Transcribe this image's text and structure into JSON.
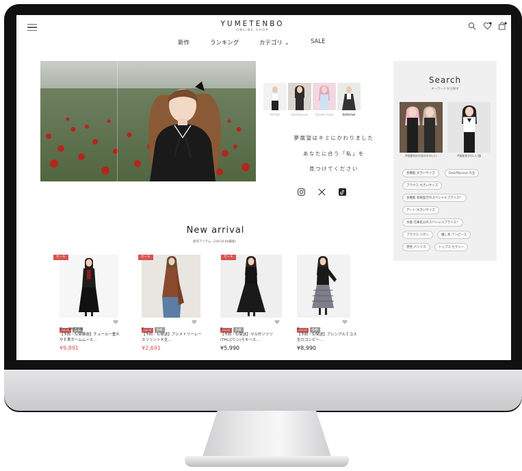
{
  "header": {
    "brand": "YUMETENBO",
    "sub": "ONLINE SHOP",
    "nav": [
      "新作",
      "ランキング",
      "カテゴリ ⌄",
      "SALE"
    ]
  },
  "hero": {
    "thumb_labels": [
      "MIYUKI",
      "DearMyLove",
      "Famille fraise",
      "bohmai"
    ],
    "tagline": [
      "夢展望はキミにかわりました",
      "あなたに合う「私」を",
      "見つけてください"
    ]
  },
  "social": [
    "instagram-icon",
    "x-icon",
    "tiktok-icon"
  ],
  "search": {
    "title": "Search",
    "subtitle": "キーワードから探す",
    "image_captions": [
      "#地雷系好の恋のかわいい",
      "#量産系かわいい服"
    ],
    "tags": [
      "多機能 大きいサイズ",
      "DearMyLove 大全",
      "ブラウス 大きいサイズ",
      "多機能 有線型行のスペシャルプライス！",
      "デート 大きいサイズ",
      "水着 在庫処分のスペシャルプライス！",
      "ブラウス リボン",
      "優し系 ワンピース",
      "男性 パンツス",
      "トップス セクシー"
    ]
  },
  "new_arrival": {
    "title": "New arrival",
    "subtitle": "新作アイテム（24h10,00最新）",
    "sale_label": "セール",
    "new_label": "NEW",
    "size_label": "多様",
    "products": [
      {
        "brand": "DearMyLove",
        "name": "【予約・5/発票遅】チュール一重ＫやＥ実ガームムース...",
        "price": "¥9,891",
        "sale": true
      },
      {
        "brand": "Rose",
        "name": "【予約・5/発送】アシメトリーレースリリントＫ生...",
        "price": "¥2,691",
        "sale": true
      },
      {
        "brand": "Rose",
        "name": "【予約・5/発送】マル升ジツリ(TH)ぷりン(ろキース...",
        "price": "¥5,990",
        "sale": true
      },
      {
        "brand": "Rose",
        "name": "【予約・5/発送】アシンプルＩコス生ロコンピー...",
        "price": "¥8,990",
        "sale": false
      }
    ]
  },
  "colors": {
    "accent": "#d9534f",
    "panel": "#f0f0f0",
    "text": "#333333",
    "frame": "#111111"
  }
}
